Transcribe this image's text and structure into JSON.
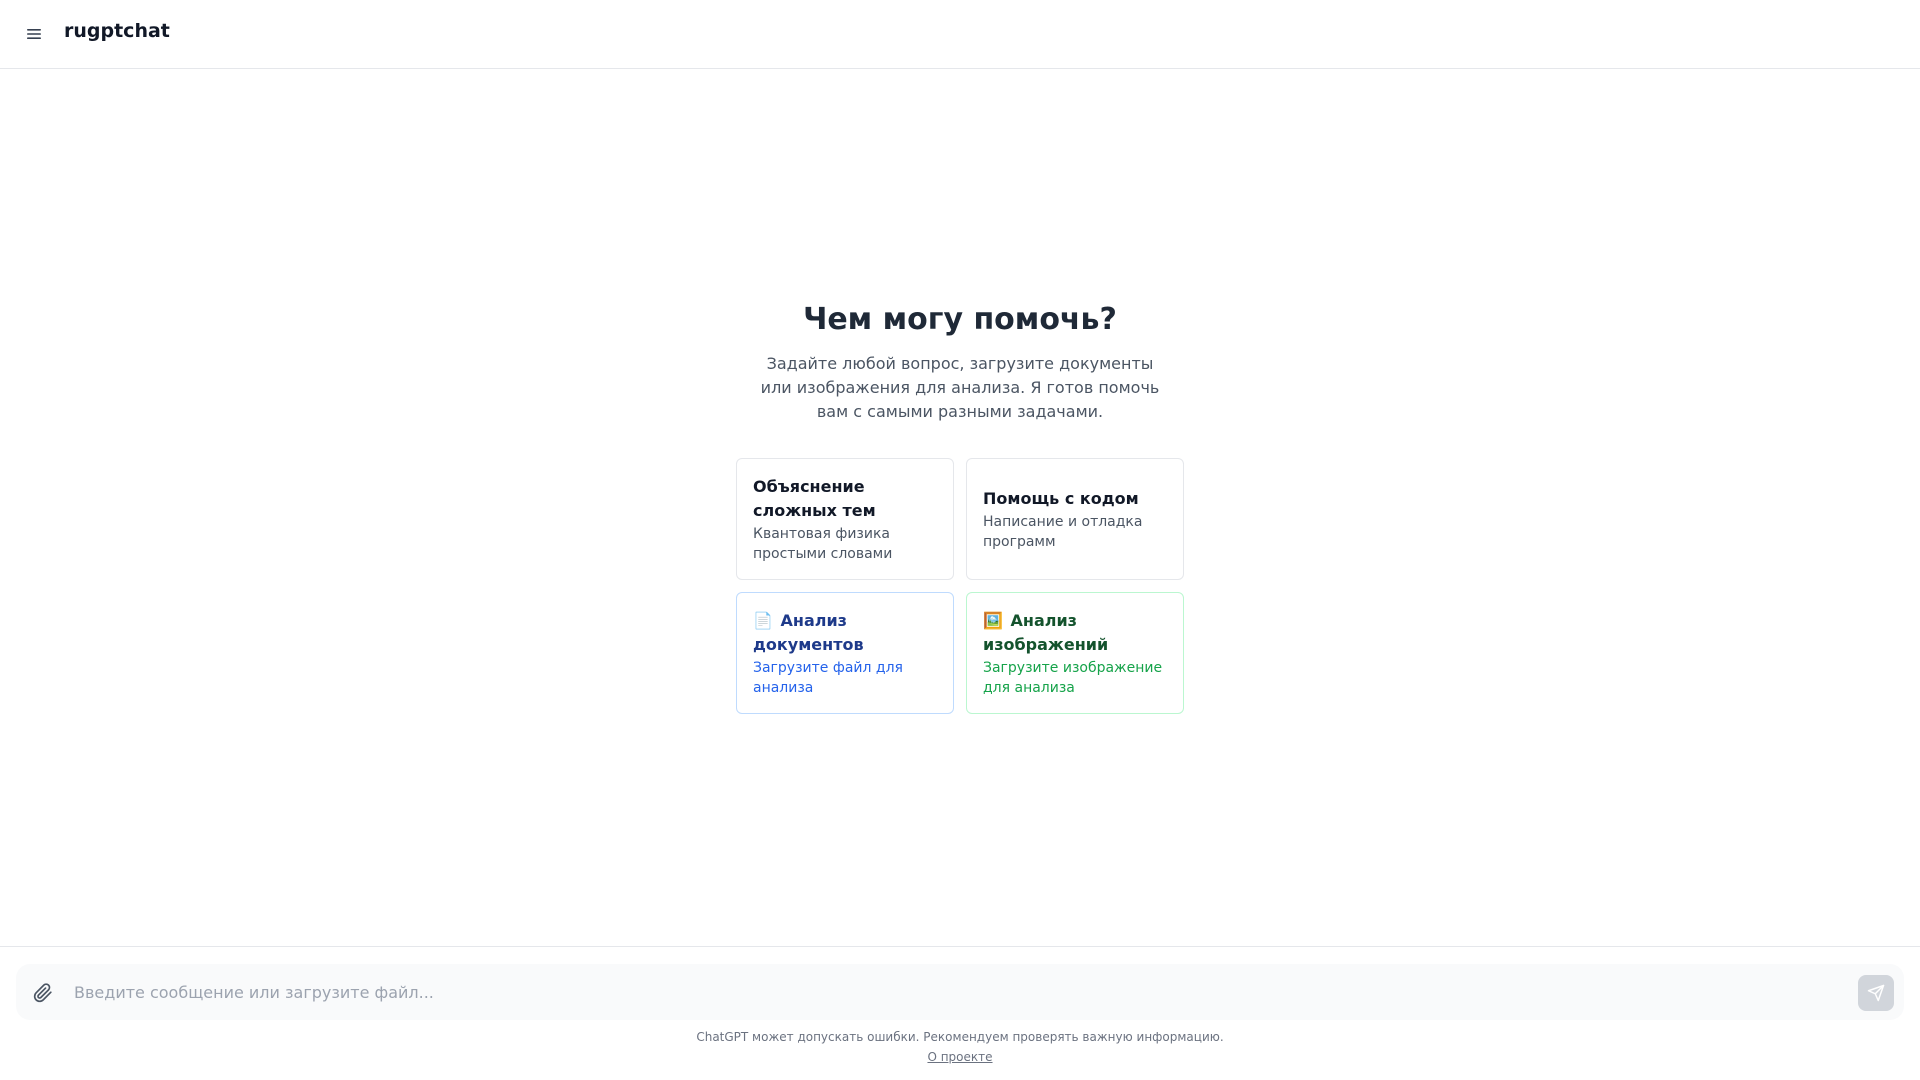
{
  "header": {
    "title": "rugptchat",
    "menu_icon": "hamburger-menu-icon"
  },
  "hero": {
    "title": "Чем могу помочь?",
    "subtitle": "Задайте любой вопрос, загрузите документы или изображения для анализа. Я готов помочь вам с самыми разными задачами."
  },
  "cards": [
    {
      "title": "Объяснение сложных тем",
      "description": "Квантовая физика простыми словами"
    },
    {
      "title": "Помощь с кодом",
      "description": "Написание и отладка программ"
    },
    {
      "emoji": "📄",
      "title": "Анализ документов",
      "description": "Загрузите файл для анализа"
    },
    {
      "emoji": "🖼️",
      "title": "Анализ изображений",
      "description": "Загрузите изображение для анализа"
    }
  ],
  "input": {
    "placeholder": "Введите сообщение или загрузите файл...",
    "value": "",
    "attach_icon": "paperclip-icon",
    "send_icon": "send-icon"
  },
  "footer": {
    "disclaimer": "ChatGPT может допускать ошибки. Рекомендуем проверять важную информацию.",
    "about_link": "О проекте"
  },
  "colors": {
    "doc_accent": "#2563eb",
    "image_accent": "#16a34a",
    "send_button_disabled": "#d1d5db"
  }
}
